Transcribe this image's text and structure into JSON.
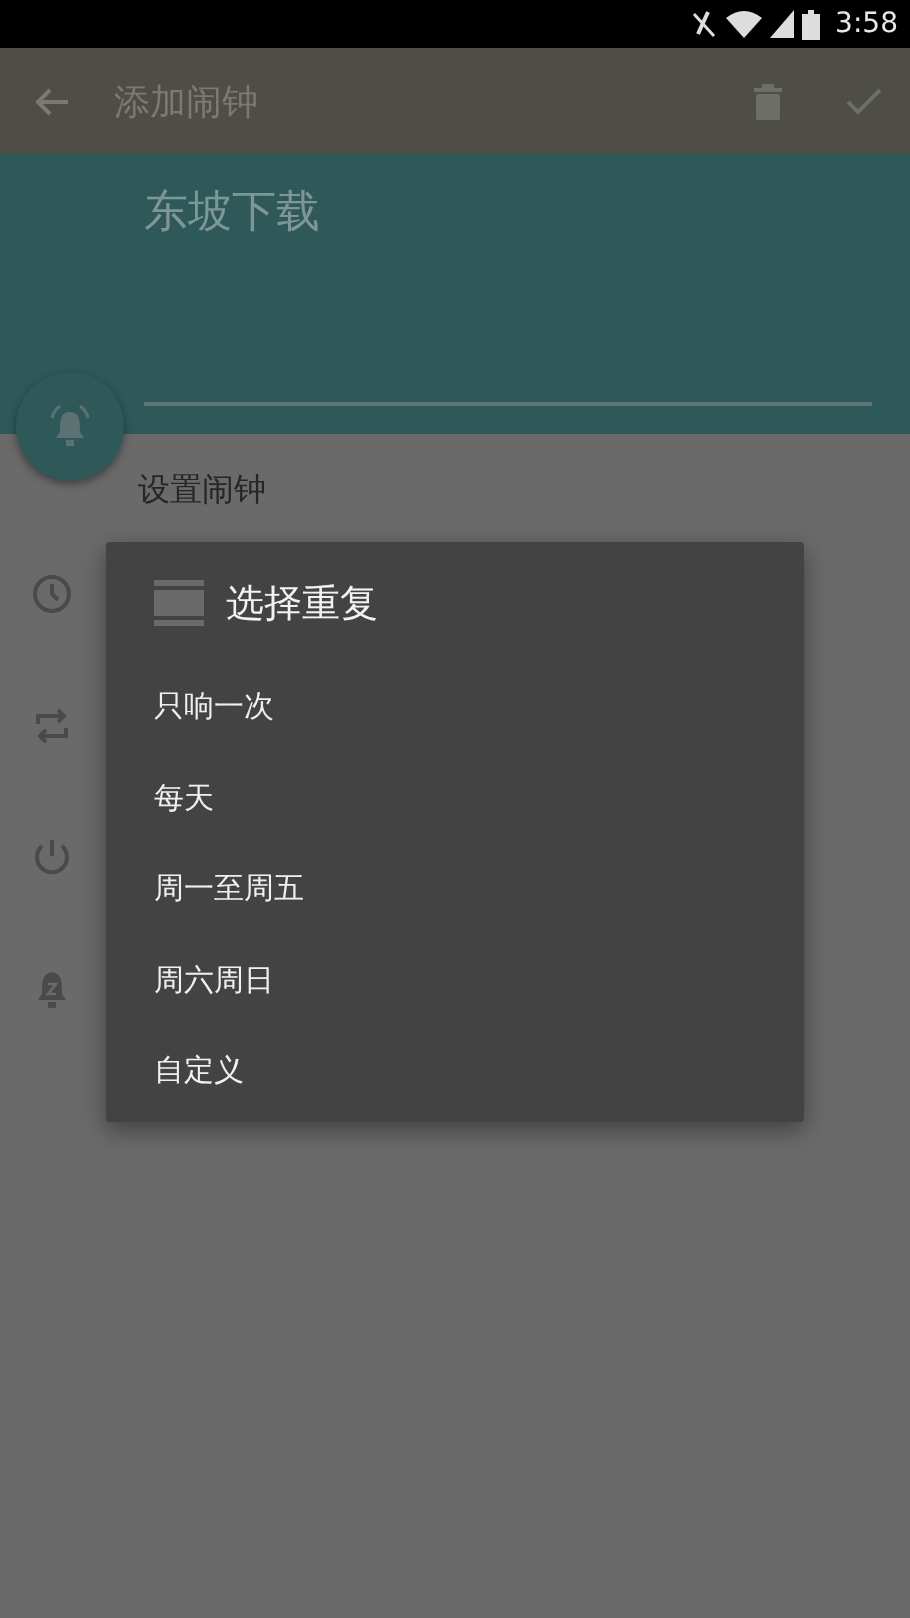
{
  "status_bar": {
    "time": "3:58"
  },
  "toolbar": {
    "title": "添加闹钟"
  },
  "name_field": {
    "value": "东坡下载"
  },
  "section_label": "设置闹钟",
  "dialog": {
    "title": "选择重复",
    "options": [
      {
        "label": "只响一次"
      },
      {
        "label": "每天"
      },
      {
        "label": "周一至周五"
      },
      {
        "label": "周六周日"
      },
      {
        "label": "自定义"
      }
    ]
  }
}
